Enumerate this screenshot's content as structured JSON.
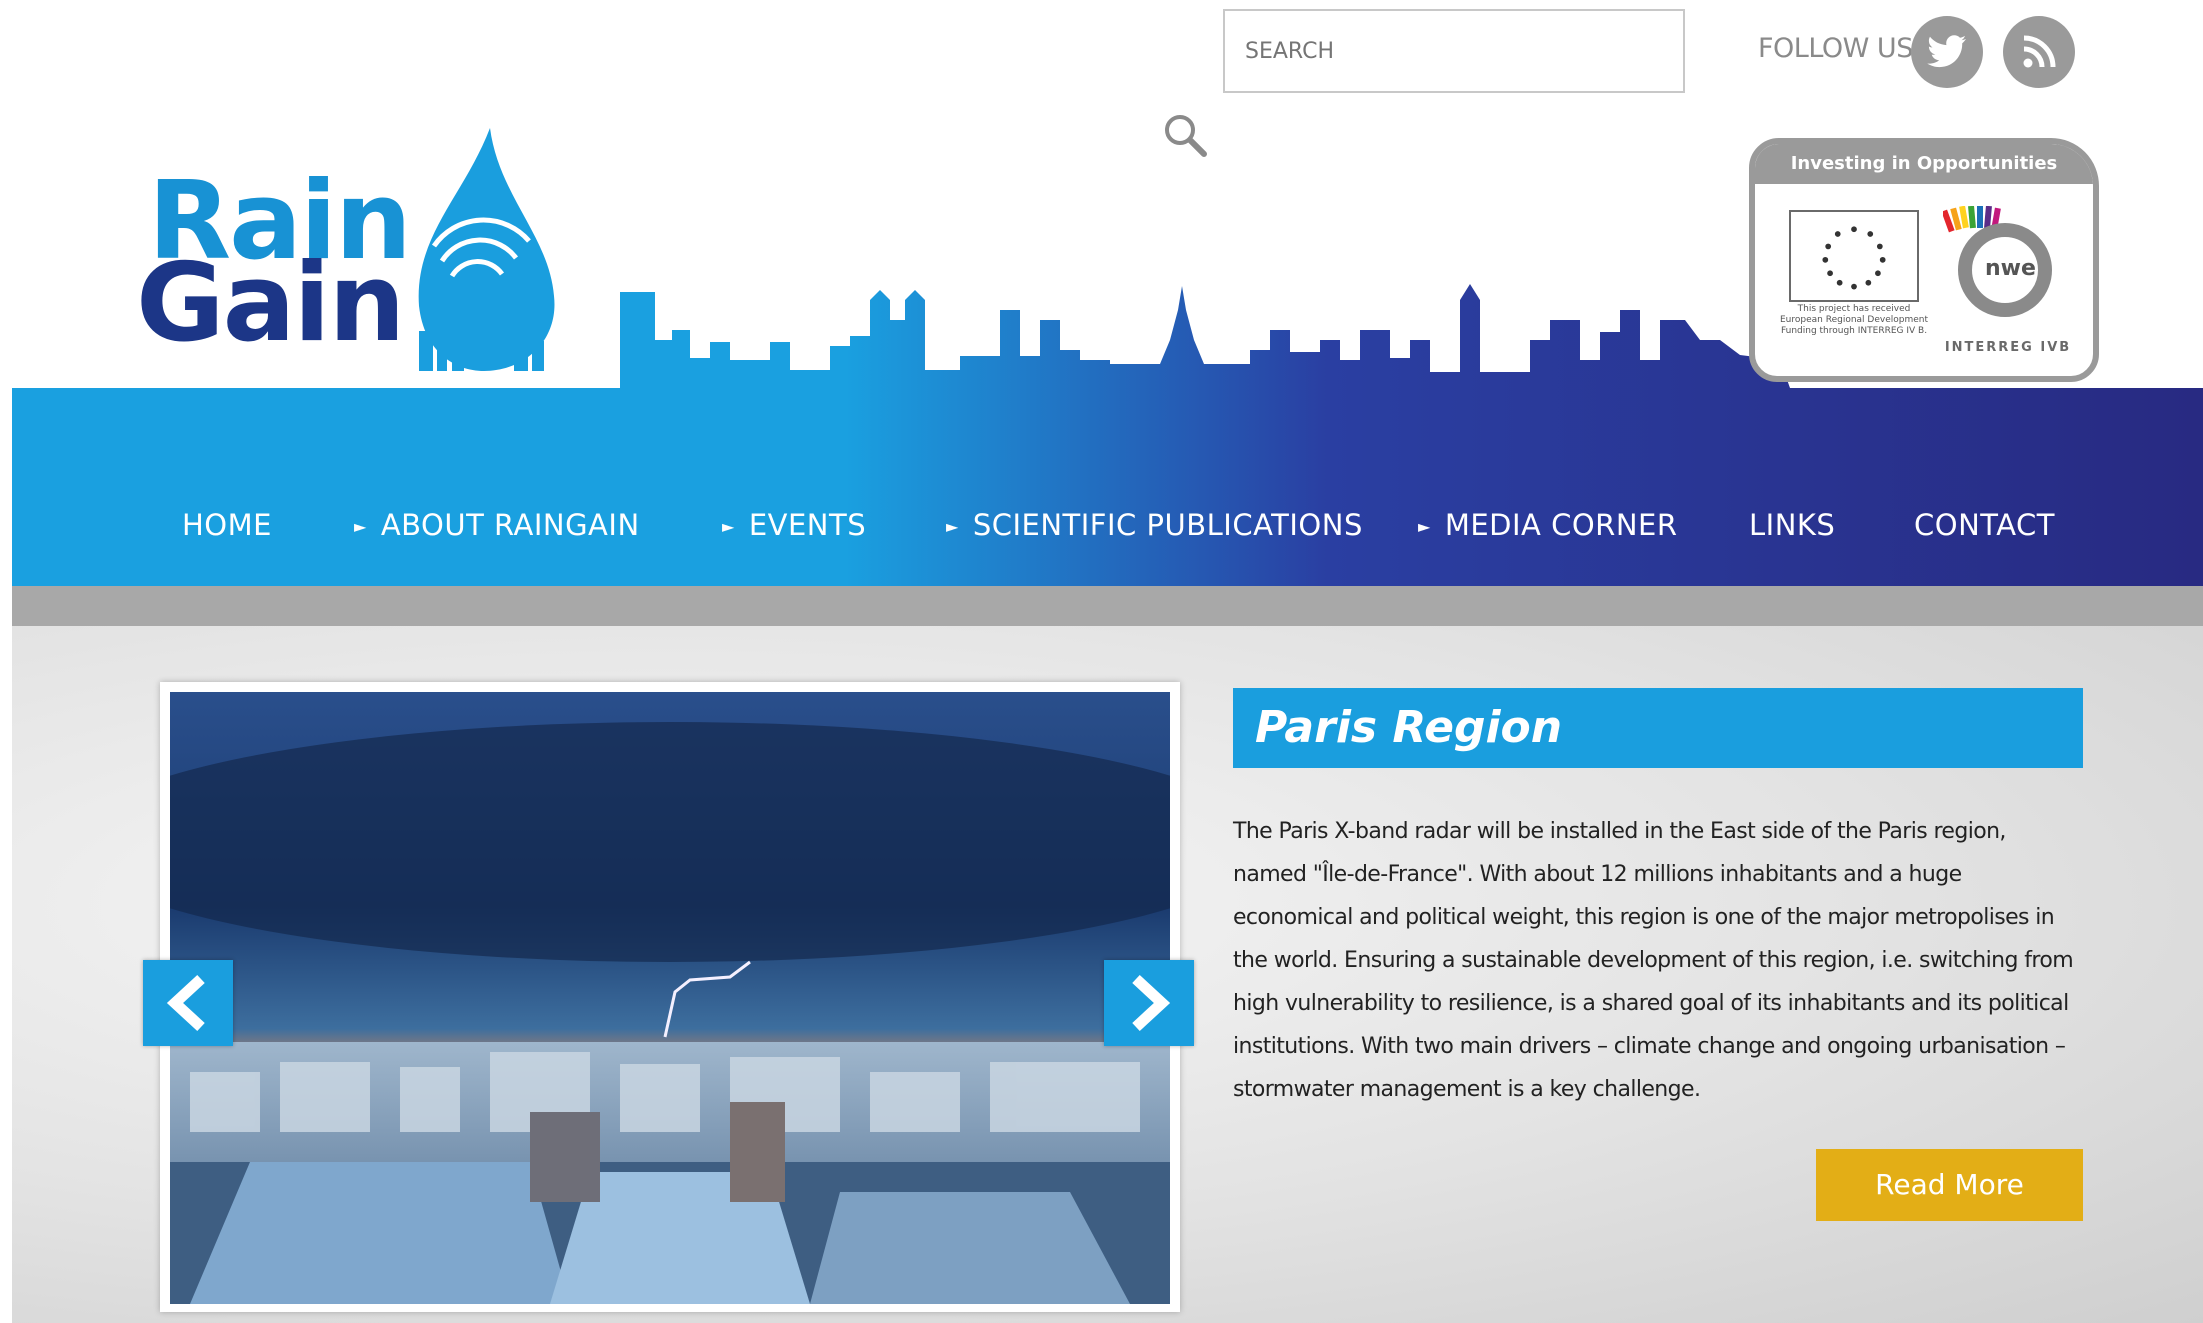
{
  "header": {
    "search_placeholder": "SEARCH",
    "follow_label": "FOLLOW US",
    "social": [
      {
        "icon": "twitter-icon"
      },
      {
        "icon": "rss-icon"
      }
    ],
    "logo": {
      "line1": "Rain",
      "line2": "Gain"
    },
    "badge": {
      "heading": "Investing in Opportunities",
      "funding_text": "This project has received European Regional Development Funding through INTERREG IV B.",
      "nwe_mark": "nwe",
      "program": "INTERREG IVB"
    }
  },
  "nav": {
    "items": [
      {
        "label": "HOME",
        "has_arrow": false
      },
      {
        "label": "ABOUT RAINGAIN",
        "has_arrow": true
      },
      {
        "label": "EVENTS",
        "has_arrow": true
      },
      {
        "label": "SCIENTIFIC PUBLICATIONS",
        "has_arrow": true
      },
      {
        "label": "MEDIA CORNER",
        "has_arrow": true
      },
      {
        "label": "LINKS",
        "has_arrow": false
      },
      {
        "label": "CONTACT",
        "has_arrow": false
      }
    ],
    "arrow_glyph": "►"
  },
  "feature": {
    "title": "Paris Region",
    "body": "The Paris X-band radar will be installed in the East side of the Paris region, named \"Île-de-France\". With about 12 millions inhabitants and a huge economical and political weight, this region is one of the major metropolises in the world. Ensuring a sustainable development of this region, i.e. switching from high vulnerability to resilience, is a shared goal of its inhabitants and its political institutions. With two main drivers – climate change and ongoing urbanisation – stormwater management is a key challenge.",
    "read_more": "Read More"
  },
  "colors": {
    "brand_light_blue": "#1a9ede",
    "brand_dark_blue": "#282a82",
    "read_more_gold": "#e3ae16",
    "social_grey": "#9a9a9a"
  }
}
